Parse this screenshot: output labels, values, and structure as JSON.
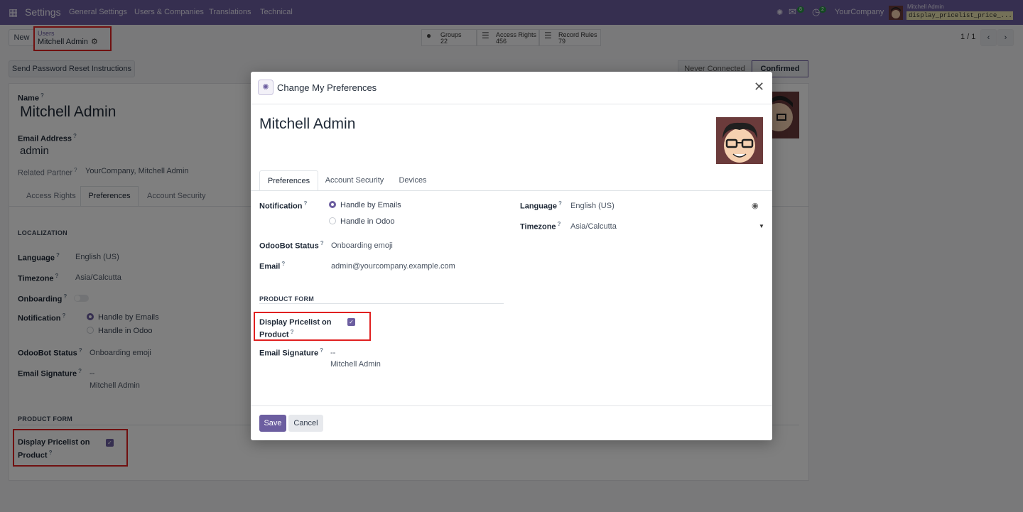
{
  "navbar": {
    "app": "Settings",
    "menu": [
      "General Settings",
      "Users & Companies",
      "Translations",
      "Technical"
    ],
    "discuss_count": "8",
    "activity_count": "2",
    "company": "YourCompany",
    "user": "Mitchell Admin",
    "db_name": "display_pricelist_price_..."
  },
  "control": {
    "new_label": "New",
    "breadcrumb_parent": "Users",
    "breadcrumb_current": "Mitchell Admin",
    "smart_buttons": [
      {
        "label": "Groups",
        "count": "22"
      },
      {
        "label": "Access Rights",
        "count": "456"
      },
      {
        "label": "Record Rules",
        "count": "79"
      }
    ],
    "pager": "1 / 1",
    "send_reset_label": "Send Password Reset Instructions",
    "status": [
      "Never Connected",
      "Confirmed"
    ]
  },
  "form": {
    "name_label": "Name",
    "name_value": "Mitchell Admin",
    "email_label": "Email Address",
    "email_value": "admin",
    "partner_label": "Related Partner",
    "partner_value": "YourCompany, Mitchell Admin",
    "tabs": [
      "Access Rights",
      "Preferences",
      "Account Security"
    ],
    "localization_title": "LOCALIZATION",
    "language_label": "Language",
    "language_value": "English (US)",
    "timezone_label": "Timezone",
    "timezone_value": "Asia/Calcutta",
    "onboarding_label": "Onboarding",
    "notification_label": "Notification",
    "notif_opt1": "Handle by Emails",
    "notif_opt2": "Handle in Odoo",
    "odoobot_label": "OdooBot Status",
    "odoobot_value": "Onboarding emoji",
    "signature_label": "Email Signature",
    "signature_line1": "--",
    "signature_line2": "Mitchell Admin",
    "product_form_title": "PRODUCT FORM",
    "pricelist_label_1": "Display Pricelist on",
    "pricelist_label_2": "Product",
    "pricelist_checked": true
  },
  "modal": {
    "title": "Change My Preferences",
    "user_name": "Mitchell Admin",
    "tabs": [
      "Preferences",
      "Account Security",
      "Devices"
    ],
    "notification_label": "Notification",
    "notif_opt1": "Handle by Emails",
    "notif_opt2": "Handle in Odoo",
    "odoobot_label": "OdooBot Status",
    "odoobot_value": "Onboarding emoji",
    "email_label": "Email",
    "email_value": "admin@yourcompany.example.com",
    "language_label": "Language",
    "language_value": "English (US)",
    "timezone_label": "Timezone",
    "timezone_value": "Asia/Calcutta",
    "product_form_title": "PRODUCT FORM",
    "pricelist_label_1": "Display Pricelist on",
    "pricelist_label_2": "Product",
    "pricelist_checked": true,
    "signature_label": "Email Signature",
    "signature_line1": "--",
    "signature_line2": "Mitchell Admin",
    "save_label": "Save",
    "cancel_label": "Cancel"
  },
  "colors": {
    "brand": "#6c5ea0",
    "highlight": "#e02020"
  }
}
